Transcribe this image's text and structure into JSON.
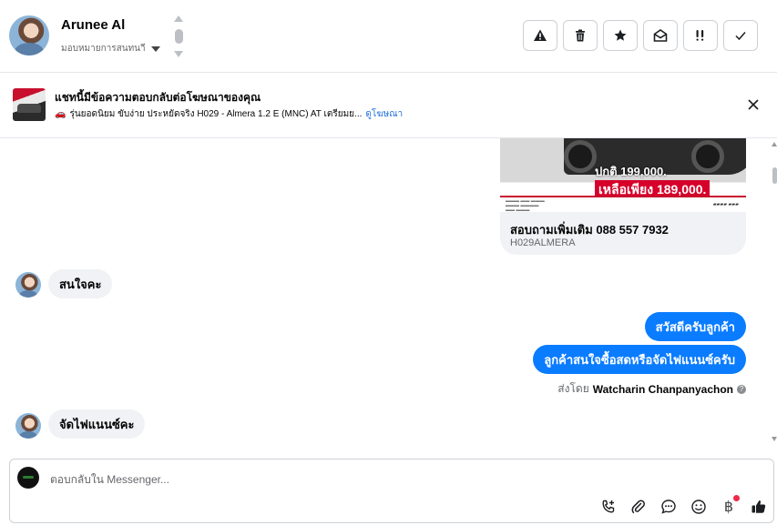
{
  "header": {
    "contact_name": "Arunee Al",
    "assign_label": "มอบหมายการสนทนาี",
    "actions": [
      {
        "name": "report-spam-button",
        "icon": "warning-icon"
      },
      {
        "name": "delete-button",
        "icon": "trash-icon"
      },
      {
        "name": "star-button",
        "icon": "star-icon"
      },
      {
        "name": "mark-unread-button",
        "icon": "envelope-open-icon"
      },
      {
        "name": "follow-up-button",
        "icon": "important-icon"
      },
      {
        "name": "mark-done-button",
        "icon": "check-icon"
      }
    ]
  },
  "ad_banner": {
    "title": "แชทนี้มีข้อความตอบกลับต่อโฆษณาของคุณ",
    "ad_text": "รุ่นยอดนิยม ขับง่าย ประหยัดจริง H029 - Almera 1.2 E (MNC) AT เตรียมย...",
    "view_ad_link": "ดูโฆษณา"
  },
  "ad_card": {
    "price_normal": "ปกติ 199,000.",
    "price_sale": "เหลือเพียง 189,000.",
    "title": "สอบถามเพิ่มเติม 088 557 7932",
    "code": "H029ALMERA"
  },
  "messages": [
    {
      "direction": "in",
      "text": "สนใจคะ"
    },
    {
      "direction": "out",
      "text": "สวัสดีครับลูกค้า"
    },
    {
      "direction": "out",
      "text": "ลูกค้าสนใจซื้อสดหรือจัดไฟแนนซ์ครับ"
    },
    {
      "direction": "in",
      "text": "จัดไฟแนนซ์คะ"
    }
  ],
  "sent_by": {
    "prefix": "ส่งโดย",
    "name": "Watcharin Chanpanyachon"
  },
  "composer": {
    "placeholder": "ตอบกลับใน Messenger...",
    "tools": [
      "call-add-icon",
      "paperclip-icon",
      "chat-bubble-icon",
      "emoji-icon",
      "baht-payment-icon",
      "thumbs-up-icon"
    ],
    "currency_symbol": "฿"
  },
  "colors": {
    "outgoing_bubble": "#0a7cff",
    "incoming_bubble": "#f0f2f5",
    "link": "#216fdb",
    "notification_dot": "#f02849"
  }
}
